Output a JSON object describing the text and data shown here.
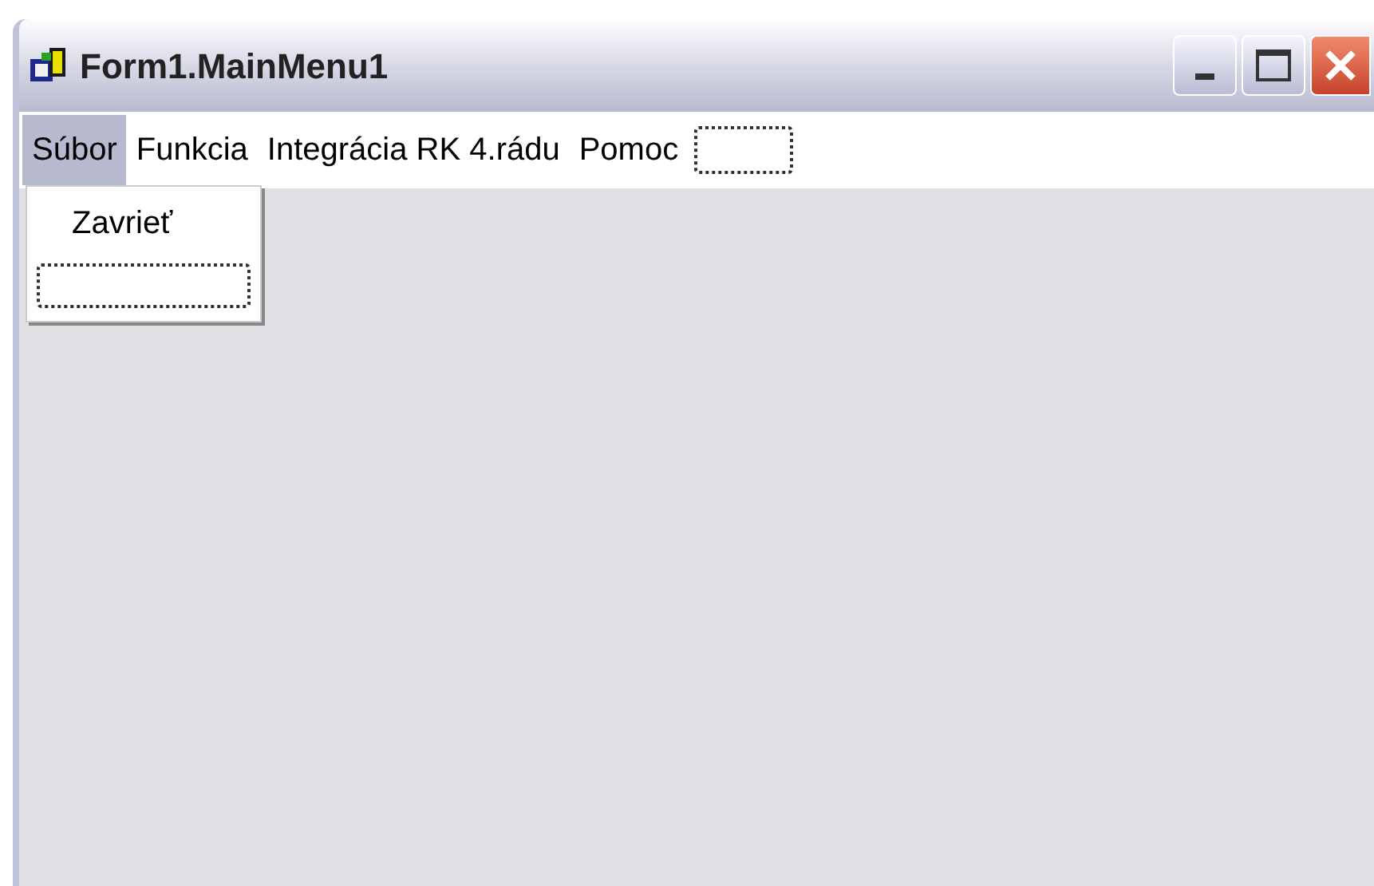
{
  "window": {
    "title": "Form1.MainMenu1"
  },
  "menu_bar": {
    "items": [
      {
        "label": "Súbor",
        "selected": true
      },
      {
        "label": "Funkcia",
        "selected": false
      },
      {
        "label": "Integrácia RK 4.rádu",
        "selected": false
      },
      {
        "label": "Pomoc",
        "selected": false
      }
    ]
  },
  "dropdown": {
    "items": [
      {
        "label": "Zavrieť"
      }
    ]
  }
}
